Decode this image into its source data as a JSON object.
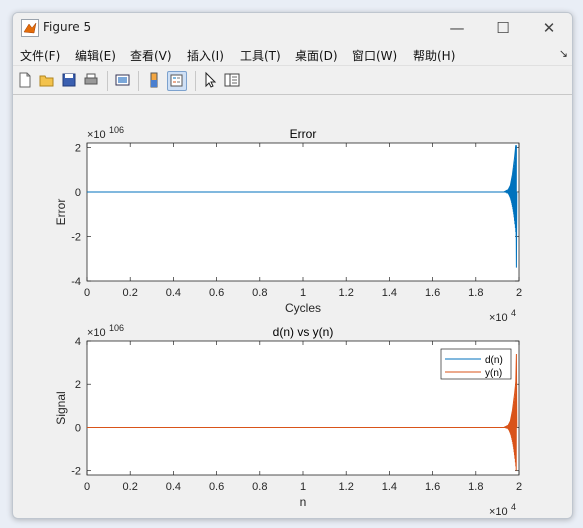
{
  "window": {
    "title": "Figure 5"
  },
  "controls": {
    "minimize": "—",
    "maximize": "☐",
    "close": "✕"
  },
  "menu": [
    {
      "label": "文件(F)"
    },
    {
      "label": "编辑(E)"
    },
    {
      "label": "查看(V)"
    },
    {
      "label": "插入(I)"
    },
    {
      "label": "工具(T)"
    },
    {
      "label": "桌面(D)"
    },
    {
      "label": "窗口(W)"
    },
    {
      "label": "帮助(H)"
    }
  ],
  "menu_arrow": "↘",
  "toolbar": [
    "new-figure-icon",
    "open-icon",
    "save-icon",
    "print-icon",
    "link-icon",
    "insert-colorbar-icon",
    "insert-legend-icon",
    "pointer-icon",
    "property-editor-icon"
  ],
  "colors": {
    "d": "#0072bd",
    "y": "#d95319",
    "axes_bg": "#ffffff"
  },
  "chart_data": [
    {
      "type": "line",
      "title": "Error",
      "xlabel": "Cycles",
      "ylabel": "Error",
      "xlim": [
        0,
        20000
      ],
      "ylim": [
        -4e+106,
        2.2e+106
      ],
      "x_exponent_label": "×10",
      "x_exponent_sup": "4",
      "y_exponent_label": "×10",
      "y_exponent_sup": "106",
      "xticks": [
        "0",
        "0.2",
        "0.4",
        "0.6",
        "0.8",
        "1",
        "1.2",
        "1.4",
        "1.6",
        "1.8",
        "2"
      ],
      "yticks": [
        "2",
        "0",
        "-2",
        "-4"
      ],
      "series": [
        {
          "x": [
            0,
            19300,
            19500,
            19600,
            19700,
            19750,
            19800,
            19850,
            19880,
            19900
          ],
          "y": [
            0,
            0,
            0.1,
            0.3,
            0.8,
            1.2,
            1.6,
            2.1,
            -3.4,
            0
          ]
        }
      ]
    },
    {
      "type": "line",
      "title": "d(n) vs y(n)",
      "xlabel": "n",
      "ylabel": "Signal",
      "xlim": [
        0,
        20000
      ],
      "ylim": [
        -2.2e+106,
        4e+106
      ],
      "x_exponent_label": "×10",
      "x_exponent_sup": "4",
      "y_exponent_label": "×10",
      "y_exponent_sup": "106",
      "xticks": [
        "0",
        "0.2",
        "0.4",
        "0.6",
        "0.8",
        "1",
        "1.2",
        "1.4",
        "1.6",
        "1.8",
        "2"
      ],
      "yticks": [
        "4",
        "2",
        "0",
        "-2"
      ],
      "legend": {
        "position": "top-right",
        "entries": [
          "d(n)",
          "y(n)"
        ]
      },
      "series": [
        {
          "name": "d(n)",
          "x": [
            0,
            19900
          ],
          "y": [
            0,
            0
          ]
        },
        {
          "name": "y(n)",
          "x": [
            0,
            19300,
            19500,
            19600,
            19700,
            19750,
            19800,
            19850,
            19880,
            19900
          ],
          "y": [
            0,
            0,
            0.1,
            0.3,
            0.8,
            1.2,
            1.6,
            2.1,
            3.4,
            0
          ]
        }
      ]
    }
  ]
}
